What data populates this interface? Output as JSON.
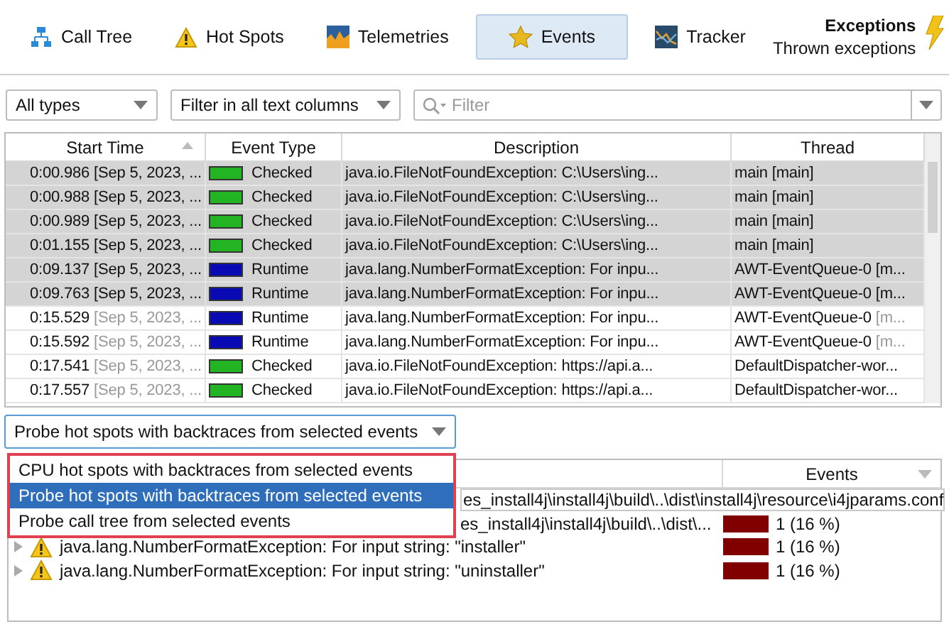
{
  "tabs": [
    {
      "label": "Call Tree",
      "selected": false
    },
    {
      "label": "Hot Spots",
      "selected": false
    },
    {
      "label": "Telemetries",
      "selected": false
    },
    {
      "label": "Events",
      "selected": true
    },
    {
      "label": "Tracker",
      "selected": false
    }
  ],
  "view": {
    "title": "Exceptions",
    "subtitle": "Thrown exceptions"
  },
  "filters": {
    "type_combo": "All types",
    "column_combo": "Filter in all text columns",
    "search": {
      "placeholder": "Filter"
    }
  },
  "table": {
    "columns": [
      "Start Time",
      "Event Type",
      "Description",
      "Thread"
    ],
    "rows": [
      {
        "time": "0:00.986",
        "time_detail": "[Sep 5, 2023, ...",
        "type": "Checked",
        "color": "#22b422",
        "description": "java.io.FileNotFoundException: C:\\Users\\ing...",
        "thread": "main [main]",
        "selected": true
      },
      {
        "time": "0:00.988",
        "time_detail": "[Sep 5, 2023, ...",
        "type": "Checked",
        "color": "#22b422",
        "description": "java.io.FileNotFoundException: C:\\Users\\ing...",
        "thread": "main [main]",
        "selected": true
      },
      {
        "time": "0:00.989",
        "time_detail": "[Sep 5, 2023, ...",
        "type": "Checked",
        "color": "#22b422",
        "description": "java.io.FileNotFoundException: C:\\Users\\ing...",
        "thread": "main [main]",
        "selected": true
      },
      {
        "time": "0:01.155",
        "time_detail": "[Sep 5, 2023, ...",
        "type": "Checked",
        "color": "#22b422",
        "description": "java.io.FileNotFoundException: C:\\Users\\ing...",
        "thread": "main [main]",
        "selected": true
      },
      {
        "time": "0:09.137",
        "time_detail": "[Sep 5, 2023, ...",
        "type": "Runtime",
        "color": "#0a0ab4",
        "description": "java.lang.NumberFormatException: For inpu...",
        "thread": "AWT-EventQueue-0",
        "thread_detail": "[m...",
        "selected": true
      },
      {
        "time": "0:09.763",
        "time_detail": "[Sep 5, 2023, ...",
        "type": "Runtime",
        "color": "#0a0ab4",
        "description": "java.lang.NumberFormatException: For inpu...",
        "thread": "AWT-EventQueue-0",
        "thread_detail": "[m...",
        "selected": true
      },
      {
        "time": "0:15.529",
        "time_detail": "[Sep 5, 2023, ...",
        "type": "Runtime",
        "color": "#0a0ab4",
        "description": "java.lang.NumberFormatException: For inpu...",
        "thread": "AWT-EventQueue-0",
        "thread_detail": "[m...",
        "selected": false
      },
      {
        "time": "0:15.592",
        "time_detail": "[Sep 5, 2023, ...",
        "type": "Runtime",
        "color": "#0a0ab4",
        "description": "java.lang.NumberFormatException: For inpu...",
        "thread": "AWT-EventQueue-0",
        "thread_detail": "[m...",
        "selected": false
      },
      {
        "time": "0:17.541",
        "time_detail": "[Sep 5, 2023, ...",
        "type": "Checked",
        "color": "#22b422",
        "description": "java.io.FileNotFoundException: https://api.a...",
        "thread": "DefaultDispatcher-wor...",
        "selected": false
      },
      {
        "time": "0:17.557",
        "time_detail": "[Sep 5, 2023, ...",
        "type": "Checked",
        "color": "#22b422",
        "description": "java.io.FileNotFoundException: https://api.a...",
        "thread": "DefaultDispatcher-wor...",
        "selected": false
      }
    ]
  },
  "analysis_combo": {
    "value": "Probe hot spots with backtraces from selected events",
    "options": [
      {
        "label": "CPU hot spots with backtraces from selected events",
        "selected": false
      },
      {
        "label": "Probe hot spots with backtraces from selected events",
        "selected": true
      },
      {
        "label": "Probe call tree from selected events",
        "selected": false
      }
    ]
  },
  "tree": {
    "columns": [
      "Events"
    ],
    "rows": [
      {
        "kind": "tooltip",
        "text": "es_install4j\\install4j\\build\\..\\dist\\install4j\\resource\\i4jparams.conf"
      },
      {
        "kind": "fragment",
        "text": "es_install4j\\install4j\\build\\..\\dist\\...",
        "events": "1 (16 %)"
      },
      {
        "kind": "node",
        "text": "java.lang.NumberFormatException: For input string: \"installer\"",
        "events": "1 (16 %)"
      },
      {
        "kind": "node",
        "text": "java.lang.NumberFormatException: For input string: \"uninstaller\"",
        "events": "1 (16 %)"
      }
    ]
  }
}
